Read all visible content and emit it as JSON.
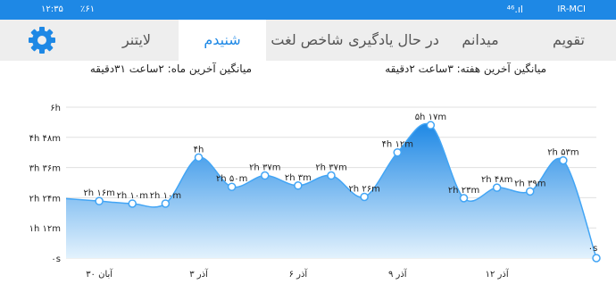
{
  "status": {
    "time": "۱۲:۳۵",
    "battery": "٪۶۱",
    "carrier": "IR-MCI",
    "signal": "⁴⁶.ıl"
  },
  "tabs": [
    {
      "label": "تقویم"
    },
    {
      "label": "میدانم"
    },
    {
      "label": "در حال یادگیری"
    },
    {
      "label": "شاخص لغت"
    },
    {
      "label": "شنیدم",
      "active": true
    },
    {
      "label": "لایتنر"
    }
  ],
  "averages": {
    "week": "میانگین آخرین هفته: ۳ساعت ۲دقیقه",
    "month": "میانگین آخرین ماه: ۲ساعت ۳۱دقیقه"
  },
  "chart_data": {
    "type": "area",
    "y_tick_labels": [
      "۰s",
      "۱h ۱۲m",
      "۲h ۲۴m",
      "۳h ۳۶m",
      "۴h ۴۸m",
      "۶h"
    ],
    "y_ticks_minutes": [
      0,
      72,
      144,
      216,
      288,
      360
    ],
    "ylim": [
      0,
      360
    ],
    "x_tick_labels": [
      "۳۰ آبان",
      "۳ آذر",
      "۶ آذر",
      "۹ آذر",
      "۱۲ آذر"
    ],
    "x_tick_index": [
      1,
      4,
      7,
      10,
      13
    ],
    "points": [
      {
        "label": "",
        "minutes": 142
      },
      {
        "label": "۲h ۱۶m",
        "minutes": 136
      },
      {
        "label": "۲h ۱۰m",
        "minutes": 130
      },
      {
        "label": "۲h ۱۰m",
        "minutes": 130
      },
      {
        "label": "۴h",
        "minutes": 240
      },
      {
        "label": "۲h ۵۰m",
        "minutes": 170
      },
      {
        "label": "۲h ۳۷m",
        "minutes": 197
      },
      {
        "label": "۲h ۳m",
        "minutes": 173
      },
      {
        "label": "۲h ۳۷m",
        "minutes": 197
      },
      {
        "label": "۲h ۲۶m",
        "minutes": 146
      },
      {
        "label": "۴h ۱۲m",
        "minutes": 252
      },
      {
        "label": "۵h ۱۷m",
        "minutes": 317
      },
      {
        "label": "۲h ۲۳m",
        "minutes": 143
      },
      {
        "label": "۲h ۴۸m",
        "minutes": 168
      },
      {
        "label": "۲h ۳۹m",
        "minutes": 159
      },
      {
        "label": "۲h ۵۳m",
        "minutes": 233
      },
      {
        "label": "۰s",
        "minutes": 0
      }
    ],
    "colors": {
      "fill_top": "#1e88e5",
      "fill_bottom": "#e3f2fd",
      "line": "#42a5f5",
      "grid": "#e0e0e0"
    }
  }
}
